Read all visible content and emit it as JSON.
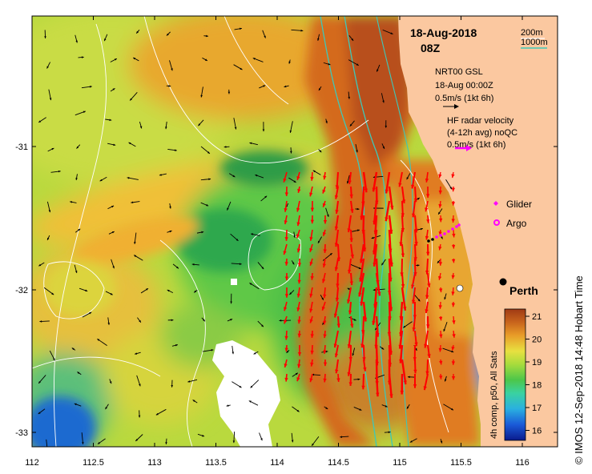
{
  "map": {
    "date_title": "18-Aug-2018",
    "time_title": "08Z",
    "depth_legend": [
      {
        "label": "200m",
        "color": "#ffffff"
      },
      {
        "label": "1000m",
        "color": "#3ec8b8"
      }
    ],
    "model_legend": {
      "line1": "NRT00 GSL",
      "line2": "18-Aug 00:00Z",
      "line3": "0.5m/s (1kt 6h)"
    },
    "radar_legend": {
      "line1": "HF radar velocity",
      "line2": "(4-12h avg) noQC",
      "line3": "0.5m/s (1kt 6h)"
    },
    "markers": {
      "glider_label": "Glider",
      "argo_label": "Argo",
      "city_label": "Perth"
    },
    "colorbar": {
      "title": "4h comp, p50, All Sats",
      "ticks": [
        "21",
        "20",
        "19",
        "18",
        "17",
        "16"
      ],
      "stops": [
        "#0a1a8c",
        "#1a5ad8",
        "#2ab0e0",
        "#3ad2a0",
        "#4cc64a",
        "#a8dc3c",
        "#e8e040",
        "#e89c28",
        "#c8641c",
        "#a03a14"
      ]
    },
    "credit": "© IMOS 12-Sep-2018 14:48 Hobart Time",
    "x_ticks": [
      "112",
      "112.5",
      "113",
      "113.5",
      "114",
      "114.5",
      "115",
      "115.5",
      "116"
    ],
    "y_ticks": [
      "-31",
      "-32",
      "-33"
    ],
    "colors": {
      "land": "#fbc8a0",
      "model_arrow": "#000000",
      "radar_arrow": "#ff0000",
      "glider": "#ff00ff",
      "argo": "#ff00ff",
      "isobath_200": "#ffffff",
      "isobath_1000": "#3ec8b8"
    }
  }
}
